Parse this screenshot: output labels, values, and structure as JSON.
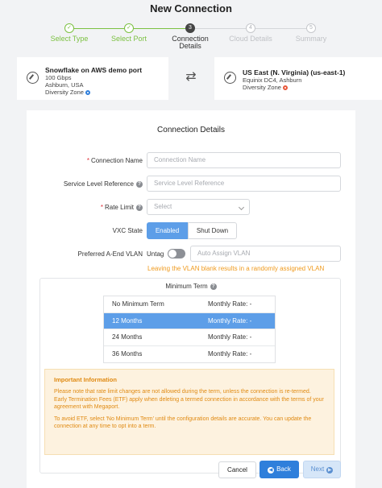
{
  "title": "New Connection",
  "steps": [
    {
      "num": "✓",
      "label": "Select Type"
    },
    {
      "num": "✓",
      "label": "Select Port"
    },
    {
      "num": "3",
      "label": "Connection Details"
    },
    {
      "num": "4",
      "label": "Cloud Details"
    },
    {
      "num": "5",
      "label": "Summary"
    }
  ],
  "a_end": {
    "name": "Snowflake on AWS demo port",
    "speed": "100 Gbps",
    "location": "Ashburn, USA",
    "zone": "Diversity Zone",
    "zone_color": "#2f7fdb"
  },
  "b_end": {
    "name": "US East (N. Virginia) (us-east-1)",
    "location": "Equinix DC4, Ashburn",
    "zone": "Diversity Zone",
    "zone_color": "#e8573a"
  },
  "form": {
    "section_title": "Connection Details",
    "connection_name": {
      "label": "Connection Name",
      "placeholder": "Connection Name"
    },
    "service_level": {
      "label": "Service Level Reference",
      "placeholder": "Service Level Reference"
    },
    "rate_limit": {
      "label": "Rate Limit",
      "placeholder": "Select"
    },
    "vxc_state": {
      "label": "VXC State",
      "enabled": "Enabled",
      "shutdown": "Shut Down"
    },
    "vlan": {
      "label": "Preferred A-End VLAN",
      "untag": "Untag",
      "placeholder": "Auto Assign VLAN",
      "hint": "Leaving the VLAN blank results in a randomly assigned VLAN"
    }
  },
  "term": {
    "title": "Minimum Term",
    "rows": [
      {
        "name": "No Minimum Term",
        "rate": "Monthly Rate: -"
      },
      {
        "name": "12 Months",
        "rate": "Monthly Rate: -"
      },
      {
        "name": "24 Months",
        "rate": "Monthly Rate: -"
      },
      {
        "name": "36 Months",
        "rate": "Monthly Rate: -"
      }
    ]
  },
  "info": {
    "heading": "Important Information",
    "p1": "Please note that rate limit changes are not allowed during the term, unless the connection is re-termed. Early Termination Fees (ETF) apply when deleting a termed connection in accordance with the terms of your agreement with Megaport.",
    "p2": "To avoid ETF, select 'No Minimum Term' until the configuration details are accurate. You can update the connection at any time to opt into a term."
  },
  "buttons": {
    "cancel": "Cancel",
    "back": "Back",
    "next": "Next"
  }
}
